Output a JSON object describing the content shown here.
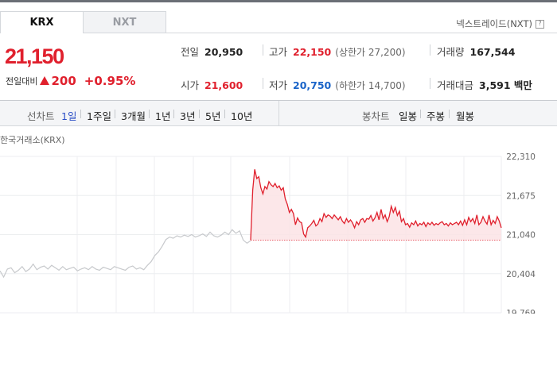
{
  "tabs": {
    "krx": "KRX",
    "nxt": "NXT"
  },
  "nxt_link": "넥스트레이드(NXT)",
  "help": "?",
  "price": "21,150",
  "change": {
    "label": "전일대비",
    "value": "200",
    "rate": "+0.95%"
  },
  "stats": {
    "prev": {
      "label": "전일",
      "value": "20,950"
    },
    "high": {
      "label": "고가",
      "value": "22,150",
      "sub": "(상한가 27,200)"
    },
    "volume": {
      "label": "거래량",
      "value": "167,544"
    },
    "open": {
      "label": "시가",
      "value": "21,600"
    },
    "low": {
      "label": "저가",
      "value": "20,750",
      "sub": "(하한가 14,700)"
    },
    "amount": {
      "label": "거래대금",
      "value": "3,591 백만"
    }
  },
  "period_bar": {
    "line_label": "선차트",
    "line_items": [
      "1일",
      "1주일",
      "3개월",
      "1년",
      "3년",
      "5년",
      "10년"
    ],
    "active": "1일",
    "candle_label": "봉차트",
    "candle_items": [
      "일봉",
      "주봉",
      "월봉"
    ]
  },
  "chart_title": "한국거래소(KRX)",
  "colors": {
    "up": "#e0202d",
    "down": "#1a64c8",
    "prev_line": "#c7c9cc"
  },
  "chart_data": {
    "type": "line",
    "y_ticks": [
      "22,310",
      "21,675",
      "21,040",
      "20,404",
      "19,769"
    ],
    "ylim": [
      19769,
      22310
    ],
    "baseline": 20950,
    "series": [
      {
        "values": [
          20450,
          20350,
          20480,
          20500,
          20420,
          20460,
          20520,
          20440,
          20480,
          20560,
          20470,
          20510,
          20530,
          20480,
          20540,
          20500,
          20460,
          20520,
          20470,
          20490,
          20510,
          20450,
          20480,
          20500,
          20470,
          20520,
          20480,
          20460,
          20510,
          20490,
          20470,
          20520,
          20500,
          20480,
          20460,
          20510,
          20530,
          20480,
          20500,
          20470,
          20540,
          20600,
          20700,
          20760,
          20850,
          20960,
          21000,
          20980,
          21020,
          21000,
          21030,
          21010,
          21040,
          21000,
          21020,
          21050,
          21010,
          21080,
          21020,
          21000,
          21030,
          21080,
          21040,
          21120,
          21060,
          21100,
          20950,
          20900,
          20940
        ]
      },
      {
        "values": [
          20950,
          21760,
          22100,
          21950,
          21980,
          21800,
          21700,
          21820,
          21780,
          21900,
          21850,
          21820,
          21870,
          21800,
          21830,
          21760,
          21800,
          21620,
          21530,
          21400,
          21450,
          21380,
          21200,
          21310,
          21250,
          21230,
          21050,
          21000,
          21150,
          21180,
          21220,
          21270,
          21180,
          21210,
          21300,
          21250,
          21380,
          21320,
          21360,
          21340,
          21300,
          21360,
          21320,
          21280,
          21330,
          21260,
          21220,
          21300,
          21240,
          21280,
          21230,
          21150,
          21250,
          21200,
          21280,
          21300,
          21240,
          21300,
          21290,
          21350,
          21260,
          21310,
          21400,
          21280,
          21450,
          21300,
          21360,
          21250,
          21330,
          21500,
          21400,
          21480,
          21350,
          21420,
          21250,
          21300,
          21200,
          21220,
          21160,
          21230,
          21200,
          21260,
          21180,
          21220,
          21200,
          21240,
          21170,
          21230,
          21200,
          21240,
          21190,
          21220,
          21200,
          21230,
          21250,
          21200,
          21220,
          21180,
          21230,
          21200,
          21220,
          21240,
          21200,
          21260,
          21190,
          21280,
          21200,
          21320,
          21250,
          21300,
          21220,
          21360,
          21200,
          21240,
          21330,
          21260,
          21210,
          21360,
          21200,
          21270,
          21220,
          21330,
          21260,
          21150
        ]
      }
    ]
  }
}
